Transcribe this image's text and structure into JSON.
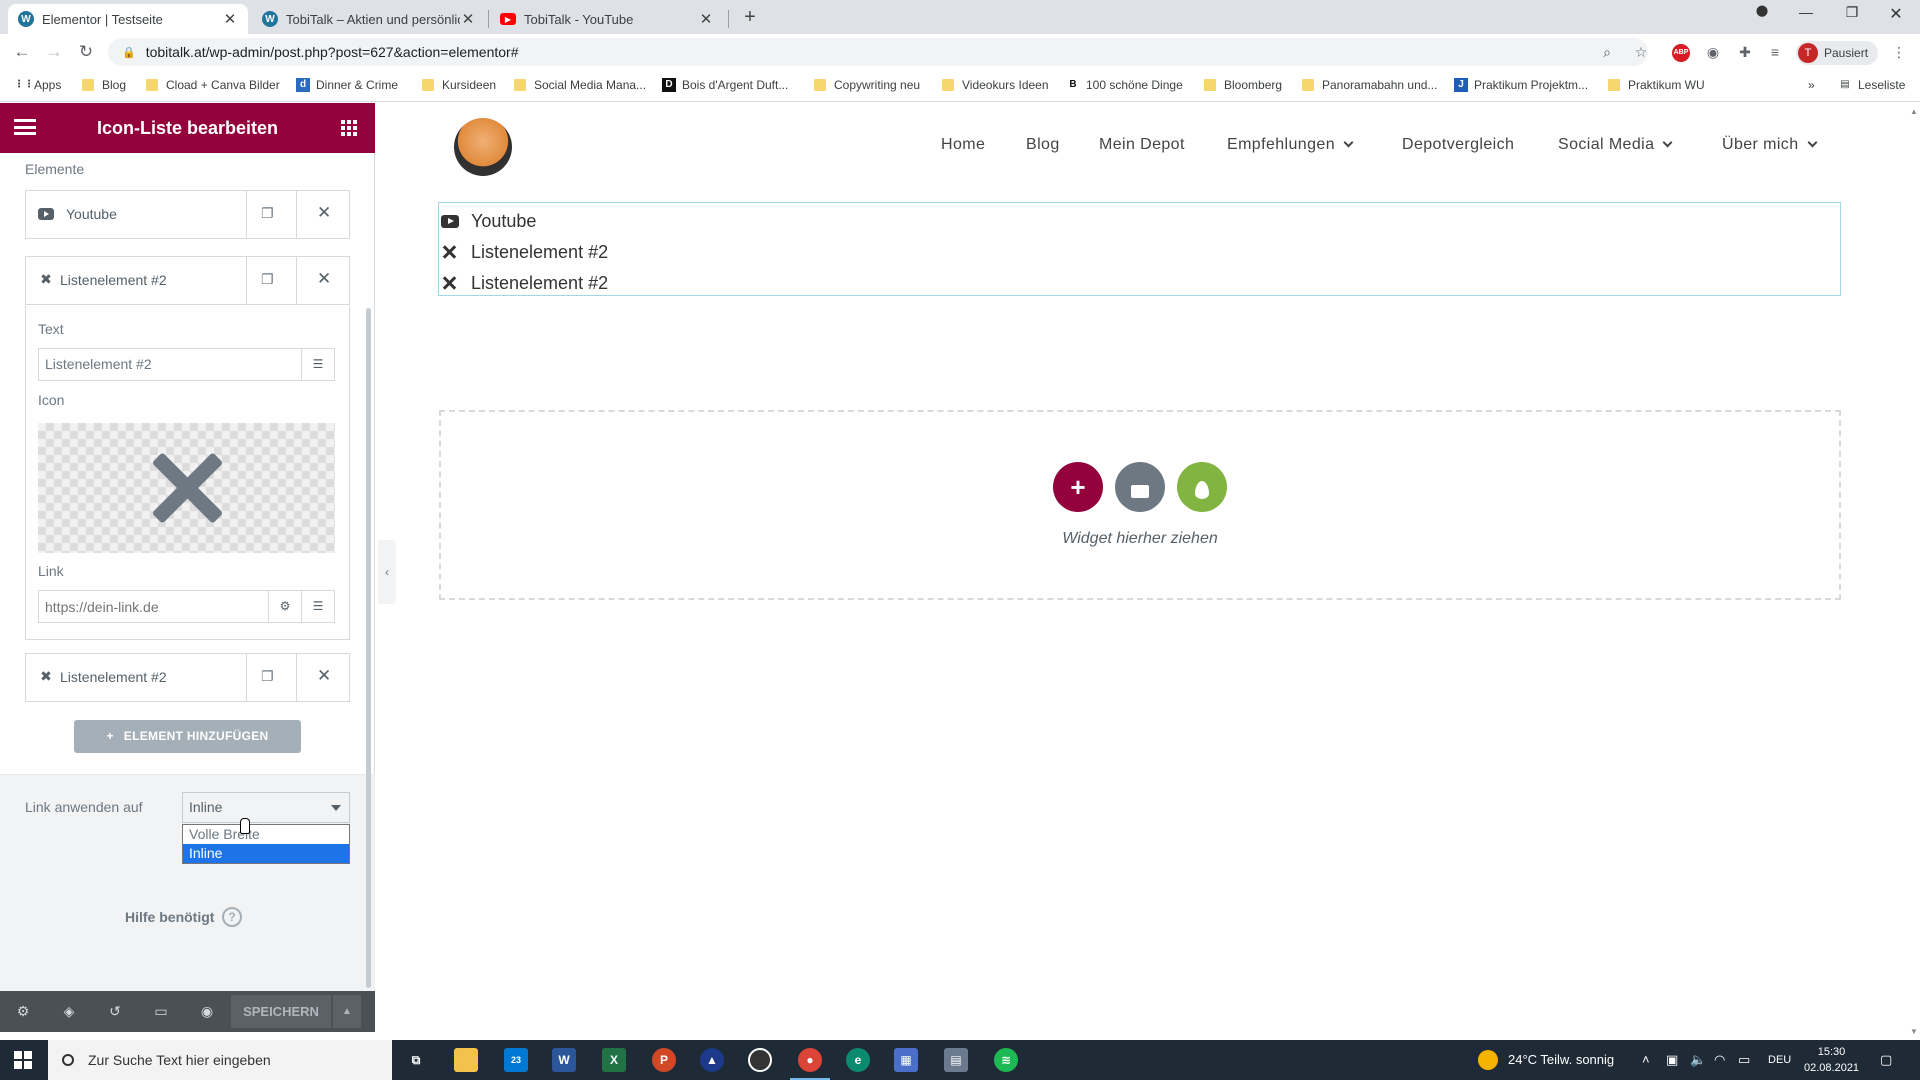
{
  "browser": {
    "tabs": [
      {
        "label": "Elementor | Testseite",
        "icon": "wordpress-icon"
      },
      {
        "label": "TobiTalk – Aktien und persönliche",
        "icon": "wordpress-icon"
      },
      {
        "label": "TobiTalk - YouTube",
        "icon": "youtube-icon"
      }
    ],
    "url": "tobitalk.at/wp-admin/post.php?post=627&action=elementor#",
    "profile_initial": "T",
    "profile_label": "Pausiert",
    "abp_label": "ABP",
    "bookmarks": [
      "Apps",
      "Blog",
      "Cload + Canva Bilder",
      "Dinner & Crime",
      "Kursideen",
      "Social Media Mana...",
      "Bois d'Argent Duft...",
      "Copywriting neu",
      "Videokurs Ideen",
      "100 schöne Dinge",
      "Bloomberg",
      "Panoramabahn und...",
      "Praktikum Projektm...",
      "Praktikum WU"
    ],
    "reading_list": "Leseliste"
  },
  "panel": {
    "title": "Icon-Liste bearbeiten",
    "section_label": "Elemente",
    "items": [
      {
        "label": "Youtube"
      },
      {
        "label": "Listenelement #2"
      },
      {
        "label": "Listenelement #2"
      }
    ],
    "text_label": "Text",
    "text_value": "Listenelement #2",
    "icon_label": "Icon",
    "link_label": "Link",
    "link_placeholder": "https://dein-link.de",
    "add_button": "ELEMENT HINZUFÜGEN",
    "link_apply_label": "Link anwenden auf",
    "link_apply_value": "Inline",
    "dropdown_options": [
      "Volle Breite",
      "Inline"
    ],
    "help": "Hilfe benötigt",
    "save": "SPEICHERN"
  },
  "site": {
    "nav": [
      "Home",
      "Blog",
      "Mein Depot",
      "Empfehlungen",
      "Depotvergleich",
      "Social Media",
      "Über mich"
    ],
    "list": [
      "Youtube",
      "Listenelement #2",
      "Listenelement #2"
    ],
    "dropzone_text": "Widget hierher ziehen"
  },
  "taskbar": {
    "search_placeholder": "Zur Suche Text hier eingeben",
    "weather": "24°C  Teilw. sonnig",
    "lang": "DEU",
    "time": "15:30",
    "date": "02.08.2021",
    "mail_badge": "23"
  },
  "colors": {
    "elementor_accent": "#93003c",
    "add_section": "#93003c",
    "template": "#6d7882",
    "envato": "#81b441"
  }
}
